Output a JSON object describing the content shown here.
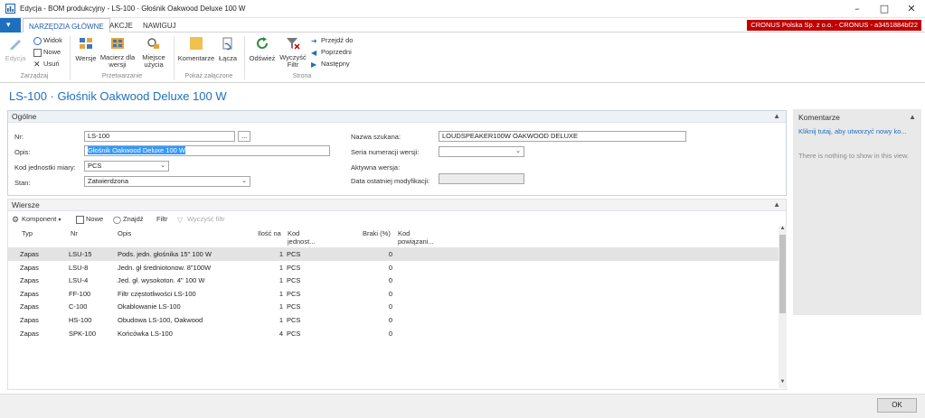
{
  "window": {
    "title": "Edycja - BOM produkcyjny - LS-100 · Głośnik Oakwood Deluxe 100 W"
  },
  "ribbon": {
    "tabs": [
      "NARZĘDZIA GŁÓWNE",
      "AKCJE",
      "NAWIGUJ"
    ],
    "company": "CRONUS Polska Sp. z o.o. - CRONUS - a3451884bf22",
    "manage": {
      "edit": "Edycja",
      "view": "Widok",
      "new": "Nowe",
      "delete": "Usuń",
      "group": "Zarządzaj"
    },
    "process": {
      "versions": "Wersje",
      "matrix": "Macierz dla wersji",
      "whereused": "Miejsce użycia",
      "group": "Przetwarzanie"
    },
    "attachments": {
      "comments": "Komentarze",
      "links": "Łącza",
      "group": "Pokaż załączone"
    },
    "page": {
      "refresh": "Odśwież",
      "clearfilter": "Wyczyść Filtr",
      "goto": "Przejdź do",
      "previous": "Poprzedni",
      "next": "Następny",
      "group": "Strona"
    }
  },
  "page_title": "LS-100 · Głośnik Oakwood Deluxe 100 W",
  "general": {
    "heading": "Ogólne",
    "no_label": "Nr:",
    "no_value": "LS-100",
    "desc_label": "Opis:",
    "desc_value": "Głośnik Oakwood Deluxe 100 W",
    "uom_label": "Kod jednostki miary:",
    "uom_value": "PCS",
    "status_label": "Stan:",
    "status_value": "Zatwierdzona",
    "search_label": "Nazwa szukana:",
    "search_value": "LOUDSPEAKER100W OAKWOOD DELUXE",
    "series_label": "Seria numeracji wersji:",
    "series_value": "",
    "active_label": "Aktywna wersja:",
    "lastmod_label": "Data ostatniej modyfikacji:"
  },
  "lines": {
    "heading": "Wiersze",
    "toolbar": {
      "component": "Komponent",
      "new": "Nowe",
      "find": "Znajdź",
      "filter": "Filtr",
      "clearfilter": "Wyczyść filtr"
    },
    "columns": {
      "type": "Typ",
      "no": "Nr",
      "desc": "Opis",
      "qty": "Ilość na",
      "code": "Kod jednost...",
      "scrap": "Braki (%)",
      "link": "Kod powiązani..."
    },
    "rows": [
      {
        "type": "Zapas",
        "no": "LSU-15",
        "desc": "Pods. jedn. głośnika 15\" 100 W",
        "qty": "1",
        "code": "PCS",
        "scrap": "0"
      },
      {
        "type": "Zapas",
        "no": "LSU-8",
        "desc": "Jedn. gł średniotonow. 8\"100W",
        "qty": "1",
        "code": "PCS",
        "scrap": "0"
      },
      {
        "type": "Zapas",
        "no": "LSU-4",
        "desc": "Jed. gł. wysokoton. 4\" 100 W",
        "qty": "1",
        "code": "PCS",
        "scrap": "0"
      },
      {
        "type": "Zapas",
        "no": "FF-100",
        "desc": "Filtr częstotliwości LS-100",
        "qty": "1",
        "code": "PCS",
        "scrap": "0"
      },
      {
        "type": "Zapas",
        "no": "C-100",
        "desc": "Okablowanie LS-100",
        "qty": "1",
        "code": "PCS",
        "scrap": "0"
      },
      {
        "type": "Zapas",
        "no": "HS-100",
        "desc": "Obudowa LS-100, Oakwood",
        "qty": "1",
        "code": "PCS",
        "scrap": "0"
      },
      {
        "type": "Zapas",
        "no": "SPK-100",
        "desc": "Końcówka LS-100",
        "qty": "4",
        "code": "PCS",
        "scrap": "0"
      }
    ]
  },
  "factbox": {
    "heading": "Komentarze",
    "link": "Kliknij tutaj, aby utworzyć nowy ko...",
    "empty": "There is nothing to show in this view."
  },
  "footer": {
    "ok": "OK"
  },
  "colors": {
    "accent": "#1f6fbf",
    "company_bg": "#c00000"
  }
}
